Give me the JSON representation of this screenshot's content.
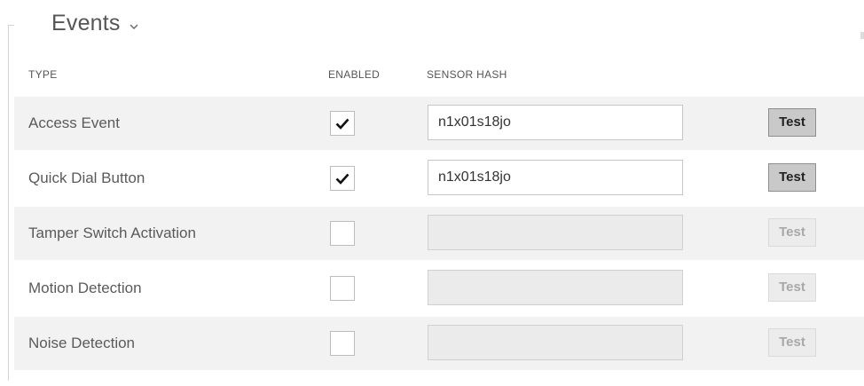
{
  "section": {
    "title": "Events",
    "chevron_icon": "chevron-down-icon"
  },
  "columns": {
    "type": "TYPE",
    "enabled": "ENABLED",
    "sensor_hash": "SENSOR HASH"
  },
  "rows": [
    {
      "label": "Access Event",
      "enabled": true,
      "hash": "n1x01s18jo",
      "test_label": "Test"
    },
    {
      "label": "Quick Dial Button",
      "enabled": true,
      "hash": "n1x01s18jo",
      "test_label": "Test"
    },
    {
      "label": "Tamper Switch Activation",
      "enabled": false,
      "hash": "",
      "test_label": "Test"
    },
    {
      "label": "Motion Detection",
      "enabled": false,
      "hash": "",
      "test_label": "Test"
    },
    {
      "label": "Noise Detection",
      "enabled": false,
      "hash": "",
      "test_label": "Test"
    }
  ]
}
